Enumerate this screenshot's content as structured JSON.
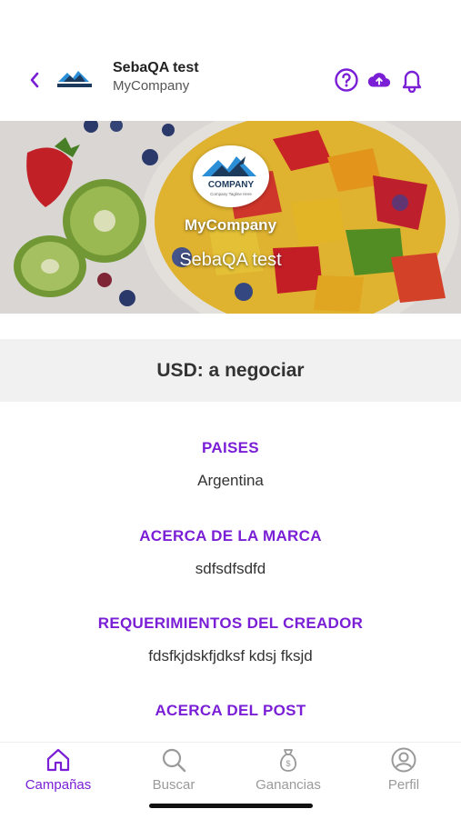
{
  "header": {
    "title": "SebaQA test",
    "subtitle": "MyCompany",
    "icons": [
      "back-chevron-icon",
      "help-icon",
      "cloud-upload-icon",
      "bell-icon"
    ]
  },
  "banner": {
    "company": "MyCompany",
    "campaign_name": "SebaQA test",
    "logo_text": "COMPANY",
    "logo_tagline": "Company Tagline Here"
  },
  "price": {
    "text": "USD: a negociar"
  },
  "sections": [
    {
      "title": "PAISES",
      "value": "Argentina"
    },
    {
      "title": "ACERCA DE LA MARCA",
      "value": "sdfsdfsdfd"
    },
    {
      "title": "REQUERIMIENTOS DEL CREADOR",
      "value": "fdsfkjdskfjdksf kdsj fksjd"
    },
    {
      "title": "ACERCA DEL POST"
    }
  ],
  "tabs": [
    {
      "label": "Campañas",
      "icon": "home-icon",
      "active": true
    },
    {
      "label": "Buscar",
      "icon": "search-icon",
      "active": false
    },
    {
      "label": "Ganancias",
      "icon": "money-bag-icon",
      "active": false
    },
    {
      "label": "Perfil",
      "icon": "profile-icon",
      "active": false
    }
  ],
  "colors": {
    "accent": "#7a1fd6",
    "inactive": "#9a9a9a",
    "band": "#f1f1f1"
  }
}
